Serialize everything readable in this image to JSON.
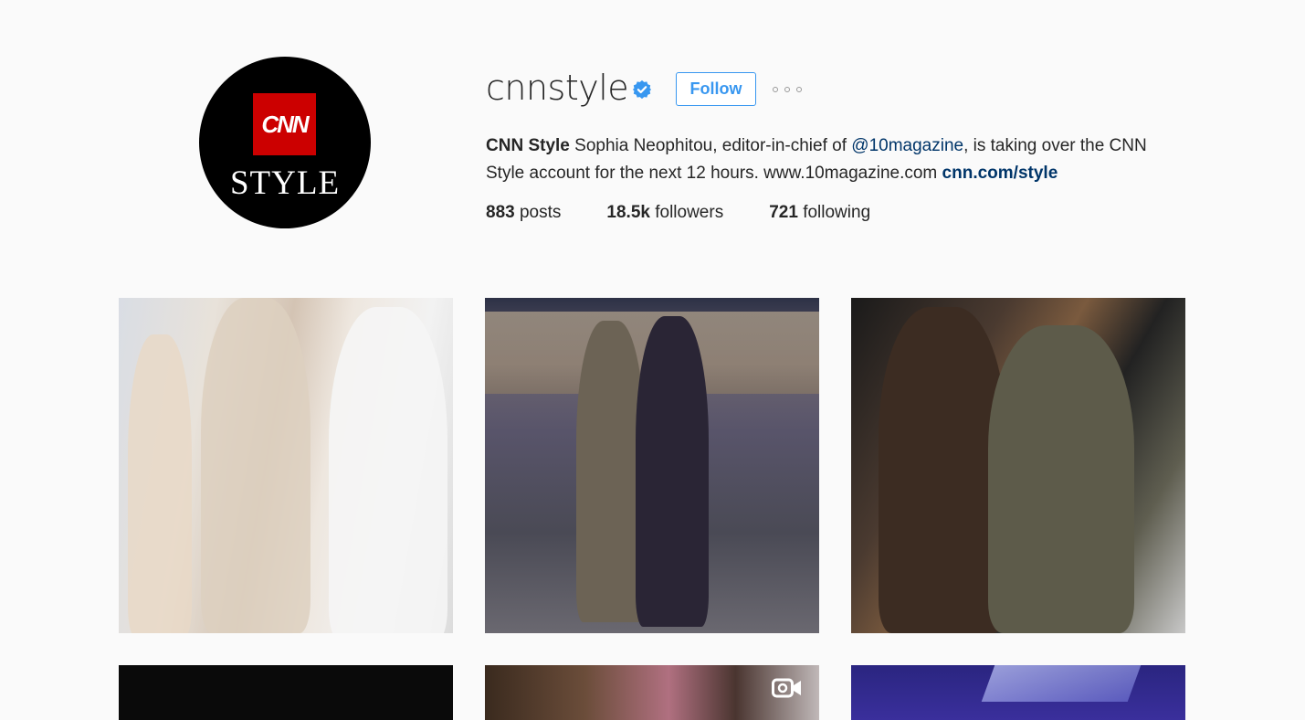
{
  "profile": {
    "avatar_logo_text": "CNN",
    "avatar_logo_sub": "STYLE",
    "username": "cnnstyle",
    "verified_icon": "verified-badge-icon",
    "follow_label": "Follow",
    "more_icon": "more-options-icon",
    "bio": {
      "name": "CNN Style",
      "text_1": "Sophia Neophitou, editor-in-chief of",
      "mention": "@10magazine",
      "text_2": ", is taking over the CNN Style account for the next 12 hours. www.10magazine.com",
      "link": "cnn.com/style"
    },
    "stats": {
      "posts_count": "883",
      "posts_label": "posts",
      "followers_count": "18.5k",
      "followers_label": "followers",
      "following_count": "721",
      "following_label": "following"
    }
  },
  "colors": {
    "accent": "#3897f0",
    "link": "#003569",
    "text": "#262626",
    "background": "#fafafa",
    "cnn_red": "#cc0000"
  },
  "posts": [
    {
      "type": "photo"
    },
    {
      "type": "photo"
    },
    {
      "type": "photo"
    },
    {
      "type": "photo"
    },
    {
      "type": "video",
      "icon": "video-camera-icon"
    },
    {
      "type": "photo"
    }
  ]
}
